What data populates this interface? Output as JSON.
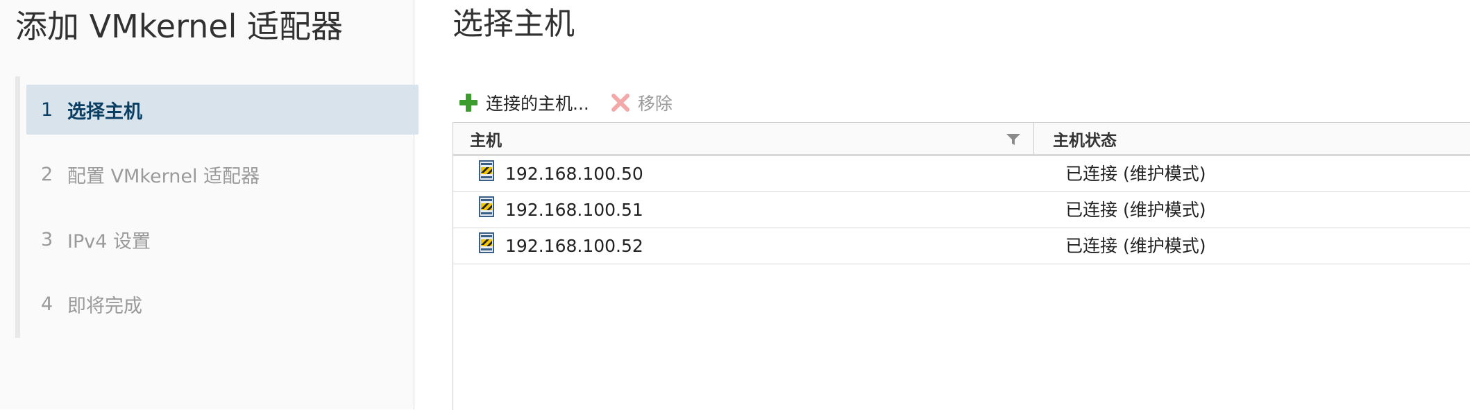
{
  "wizard": {
    "title": "添加 VMkernel 适配器",
    "steps": [
      {
        "num": "1",
        "label": "选择主机",
        "active": true
      },
      {
        "num": "2",
        "label": "配置 VMkernel 适配器",
        "active": false
      },
      {
        "num": "3",
        "label": "IPv4 设置",
        "active": false
      },
      {
        "num": "4",
        "label": "即将完成",
        "active": false
      }
    ]
  },
  "main": {
    "title": "选择主机",
    "toolbar": {
      "add_label": "连接的主机...",
      "add_icon": "plus-icon",
      "remove_label": "移除",
      "remove_icon": "close-icon"
    },
    "table": {
      "columns": [
        "主机",
        "主机状态"
      ],
      "rows": [
        {
          "host": "192.168.100.50",
          "state": "已连接 (维护模式)"
        },
        {
          "host": "192.168.100.51",
          "state": "已连接 (维护模式)"
        },
        {
          "host": "192.168.100.52",
          "state": "已连接 (维护模式)"
        }
      ]
    }
  },
  "colors": {
    "active_step_bg": "#d8e3eb",
    "active_step_text": "#0a3e63",
    "add_icon": "#3c9c2e",
    "remove_icon": "#f3a9a9"
  }
}
